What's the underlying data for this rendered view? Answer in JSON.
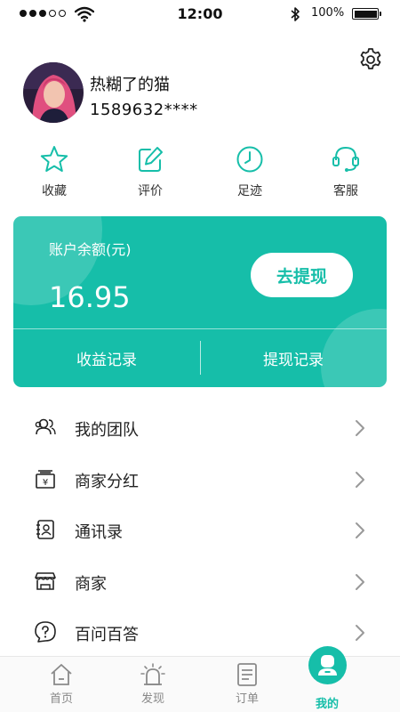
{
  "status_bar": {
    "time": "12:00",
    "battery": "100%"
  },
  "profile": {
    "nickname": "热糊了的猫",
    "phone": "1589632****"
  },
  "quick_actions": [
    {
      "label": "收藏",
      "icon": "star-icon"
    },
    {
      "label": "评价",
      "icon": "edit-icon"
    },
    {
      "label": "足迹",
      "icon": "clock-icon"
    },
    {
      "label": "客服",
      "icon": "headset-icon"
    }
  ],
  "balance_card": {
    "label": "账户余额(元)",
    "amount": "16.95",
    "withdraw_button": "去提现",
    "income_records": "收益记录",
    "withdraw_records": "提现记录"
  },
  "menu": [
    {
      "label": "我的团队",
      "icon": "team-icon"
    },
    {
      "label": "商家分红",
      "icon": "dividend-icon"
    },
    {
      "label": "通讯录",
      "icon": "contacts-icon"
    },
    {
      "label": "商家",
      "icon": "store-icon"
    },
    {
      "label": "百问百答",
      "icon": "question-icon"
    }
  ],
  "tab_bar": [
    {
      "label": "首页",
      "icon": "home-icon"
    },
    {
      "label": "发现",
      "icon": "discover-icon"
    },
    {
      "label": "订单",
      "icon": "order-icon"
    },
    {
      "label": "我的",
      "icon": "user-icon",
      "active": true
    }
  ],
  "colors": {
    "accent": "#16bea9",
    "text": "#222222",
    "tab_inactive": "#888888"
  }
}
